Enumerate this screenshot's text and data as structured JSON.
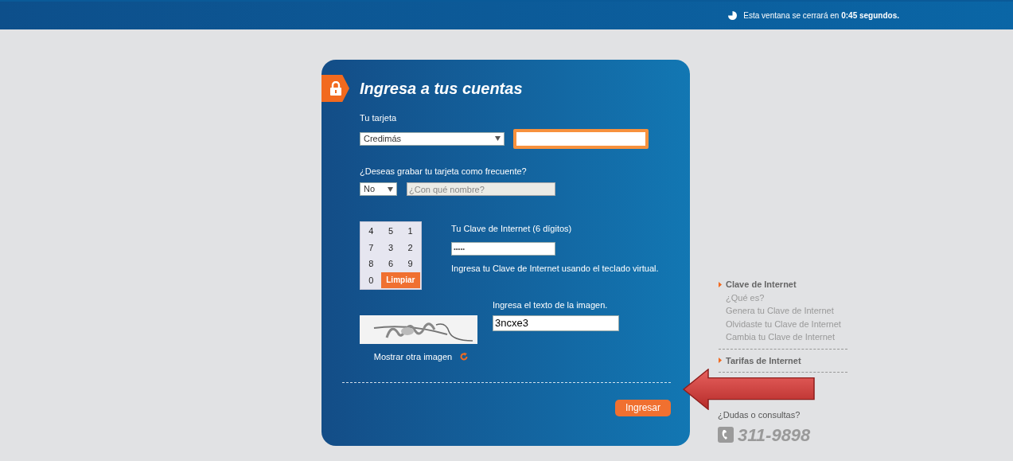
{
  "top_bar": {
    "message": "Esta ventana se cerrará en **0:45 segundos.**"
  },
  "login": {
    "title": "Ingresa a tus cuentas",
    "card_label": "Tu tarjeta",
    "card_type": "Credimás",
    "card_number": {
      "focused": true
    },
    "frequent_label": "¿Deseas grabar tu tarjeta como frecuente?",
    "frequent_choice": "No",
    "name_placeholder": "¿Con qué nombre?",
    "keypad": {
      "keys": [
        "4",
        "5",
        "1",
        "7",
        "3",
        "2",
        "8",
        "6",
        "9",
        "0"
      ],
      "clear": "Limpiar"
    },
    "password_label": "Tu Clave de Internet (6 dígitos)",
    "password_value": "•••••",
    "password_hint": "Ingresa tu Clave de Internet usando el teclado virtual.",
    "captcha": {
      "label": "Ingresa el texto de la imagen.",
      "value": "3ncxe3",
      "refresh": "Mostrar otra imagen"
    },
    "submit": "Ingresar"
  },
  "sidebar": {
    "sections": [
      {
        "title": "Clave de Internet",
        "links": [
          "¿Qué es?",
          "Genera tu Clave de Internet",
          "Olvidaste tu Clave de Internet",
          "Cambia tu Clave de Internet"
        ]
      },
      {
        "title": "Tarifas de Internet"
      }
    ]
  },
  "help": {
    "question": "¿Dudas o consultas?",
    "phone": "311-9898"
  }
}
